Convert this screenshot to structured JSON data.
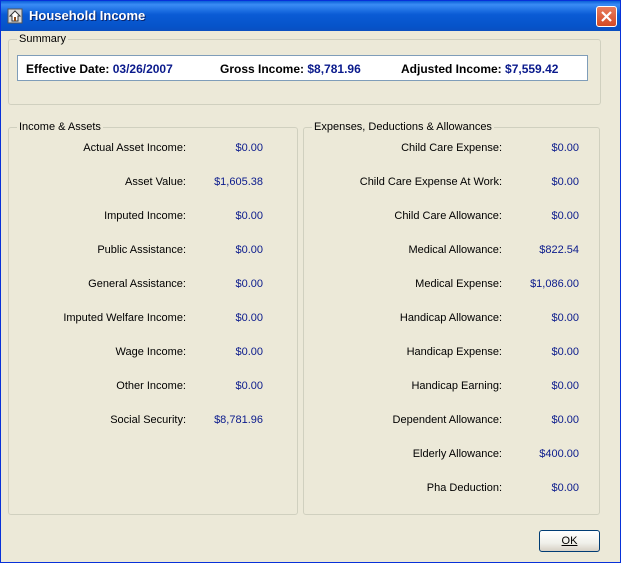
{
  "window": {
    "title": "Household Income",
    "icon": "house-icon",
    "close_icon": "close-icon"
  },
  "summary": {
    "group_label": "Summary",
    "effective_date_label": "Effective Date:",
    "effective_date_value": "03/26/2007",
    "gross_income_label": "Gross Income:",
    "gross_income_value": "$8,781.96",
    "adjusted_income_label": "Adjusted Income:",
    "adjusted_income_value": "$7,559.42"
  },
  "income_assets": {
    "group_label": "Income & Assets",
    "rows": [
      {
        "label": "Actual Asset Income:",
        "value": "$0.00"
      },
      {
        "label": "Asset Value:",
        "value": "$1,605.38"
      },
      {
        "label": "Imputed Income:",
        "value": "$0.00"
      },
      {
        "label": "Public Assistance:",
        "value": "$0.00"
      },
      {
        "label": "General Assistance:",
        "value": "$0.00"
      },
      {
        "label": "Imputed Welfare Income:",
        "value": "$0.00"
      },
      {
        "label": "Wage Income:",
        "value": "$0.00"
      },
      {
        "label": "Other Income:",
        "value": "$0.00"
      },
      {
        "label": "Social Security:",
        "value": "$8,781.96"
      }
    ]
  },
  "expenses": {
    "group_label": "Expenses, Deductions & Allowances",
    "rows": [
      {
        "label": "Child Care Expense:",
        "value": "$0.00"
      },
      {
        "label": "Child Care Expense At Work:",
        "value": "$0.00"
      },
      {
        "label": "Child Care Allowance:",
        "value": "$0.00"
      },
      {
        "label": "Medical Allowance:",
        "value": "$822.54"
      },
      {
        "label": "Medical Expense:",
        "value": "$1,086.00"
      },
      {
        "label": "Handicap Allowance:",
        "value": "$0.00"
      },
      {
        "label": "Handicap Expense:",
        "value": "$0.00"
      },
      {
        "label": "Handicap Earning:",
        "value": "$0.00"
      },
      {
        "label": "Dependent Allowance:",
        "value": "$0.00"
      },
      {
        "label": "Elderly Allowance:",
        "value": "$400.00"
      },
      {
        "label": "Pha Deduction:",
        "value": "$0.00"
      }
    ]
  },
  "buttons": {
    "ok_label": "OK"
  }
}
